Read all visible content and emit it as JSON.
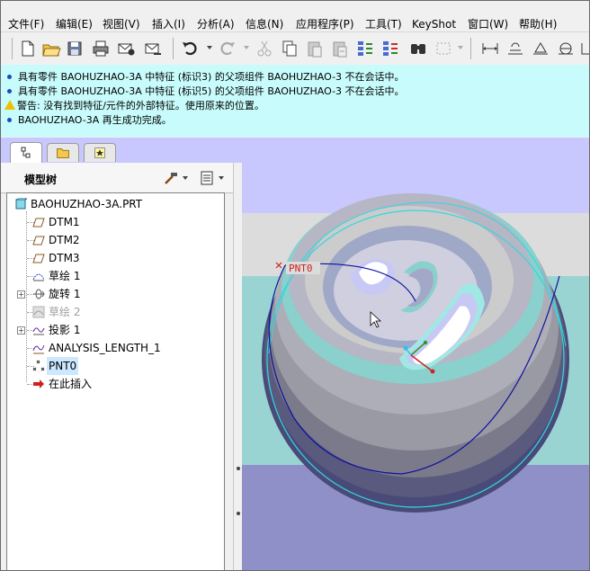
{
  "menubar": {
    "items": [
      "文件(F)",
      "编辑(E)",
      "视图(V)",
      "插入(I)",
      "分析(A)",
      "信息(N)",
      "应用程序(P)",
      "工具(T)",
      "KeyShot",
      "窗口(W)",
      "帮助(H)"
    ]
  },
  "toolbar": {
    "buttons": [
      "new-icon",
      "open-icon",
      "save-icon",
      "print-icon",
      "email-icon",
      "email-link-icon",
      "undo-icon",
      "redo-icon",
      "cut-icon",
      "copy-icon",
      "paste-icon",
      "paste-special-icon",
      "regenerate-icon",
      "regenerate-manager-icon",
      "find-icon",
      "select-box-icon",
      "dimension-icon",
      "plane-icon",
      "axis-icon",
      "point-icon",
      "csys-icon"
    ]
  },
  "messages": [
    {
      "type": "info",
      "text": "具有零件 BAOHUZHAO-3A 中特征 (标识3) 的父项组件 BAOHUZHAO-3 不在会话中。"
    },
    {
      "type": "info",
      "text": "具有零件 BAOHUZHAO-3A 中特征 (标识5) 的父项组件 BAOHUZHAO-3 不在会话中。"
    },
    {
      "type": "warning",
      "text": "警告: 没有找到特征/元件的外部特征。使用原来的位置。"
    },
    {
      "type": "info",
      "text": "BAOHUZHAO-3A 再生成功完成。"
    }
  ],
  "tree": {
    "title": "模型树",
    "root": "BAOHUZHAO-3A.PRT",
    "items": [
      {
        "label": "DTM1",
        "icon": "datum-plane-icon",
        "expandable": false,
        "dim": false,
        "selected": false
      },
      {
        "label": "DTM2",
        "icon": "datum-plane-icon",
        "expandable": false,
        "dim": false,
        "selected": false
      },
      {
        "label": "DTM3",
        "icon": "datum-plane-icon",
        "expandable": false,
        "dim": false,
        "selected": false
      },
      {
        "label": "草绘 1",
        "icon": "sketch-icon",
        "expandable": false,
        "dim": false,
        "selected": false
      },
      {
        "label": "旋转 1",
        "icon": "revolve-icon",
        "expandable": true,
        "dim": false,
        "selected": false
      },
      {
        "label": "草绘 2",
        "icon": "sketch-suppressed-icon",
        "expandable": false,
        "dim": true,
        "selected": false
      },
      {
        "label": "投影 1",
        "icon": "projection-icon",
        "expandable": true,
        "dim": false,
        "selected": false
      },
      {
        "label": "ANALYSIS_LENGTH_1",
        "icon": "analysis-icon",
        "expandable": false,
        "dim": false,
        "selected": false
      },
      {
        "label": "PNT0",
        "icon": "datum-point-icon",
        "expandable": false,
        "dim": false,
        "selected": true
      },
      {
        "label": "在此插入",
        "icon": "insert-here-arrow-icon",
        "expandable": false,
        "dim": false,
        "selected": false
      }
    ]
  },
  "viewport": {
    "point_label": "PNT0",
    "background_top": "#c8c8ff",
    "accent_curve": "#1010a0"
  }
}
